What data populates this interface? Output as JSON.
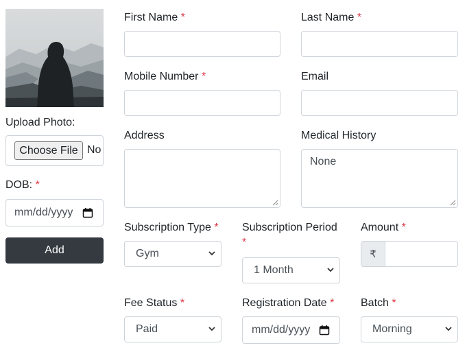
{
  "photo": {
    "alt_icon": "hooded-figure-mountains-photo"
  },
  "upload": {
    "label": "Upload Photo:",
    "button": "Choose File",
    "status": "No"
  },
  "dob": {
    "label": "DOB:",
    "required": "*",
    "placeholder": "mm/dd/yyyy"
  },
  "add_button": "Add",
  "fields": {
    "first_name": {
      "label": "First Name",
      "required": "*"
    },
    "last_name": {
      "label": "Last Name",
      "required": "*"
    },
    "mobile": {
      "label": "Mobile Number",
      "required": "*"
    },
    "email": {
      "label": "Email"
    },
    "address": {
      "label": "Address"
    },
    "medical_history": {
      "label": "Medical History",
      "value": "None"
    },
    "subscription_type": {
      "label": "Subscription Type",
      "required": "*",
      "value": "Gym"
    },
    "subscription_period": {
      "label": "Subscription Period",
      "required": "*",
      "value": "1 Month"
    },
    "amount": {
      "label": "Amount",
      "required": "*",
      "currency": "₹"
    },
    "fee_status": {
      "label": "Fee Status",
      "required": "*",
      "value": "Paid"
    },
    "registration_date": {
      "label": "Registration Date",
      "required": "*",
      "placeholder": "mm/dd/yyyy"
    },
    "batch": {
      "label": "Batch",
      "required": "*",
      "value": "Morning"
    }
  },
  "colors": {
    "required": "#dc3545",
    "button_dark": "#343a40",
    "border": "#ced4da",
    "addon_bg": "#e9ecef"
  }
}
